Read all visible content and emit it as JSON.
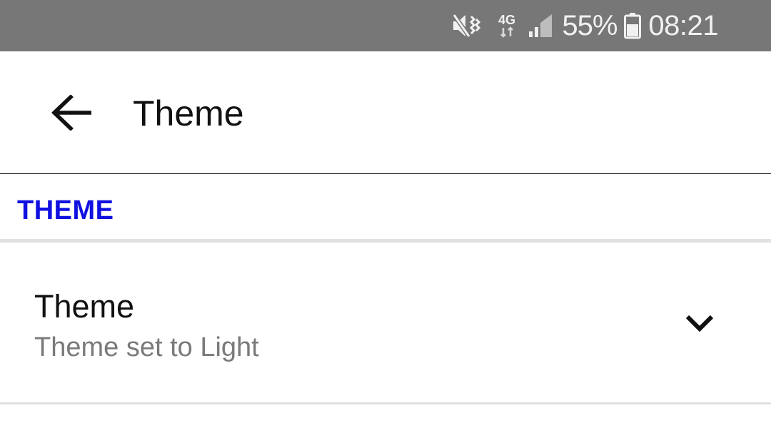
{
  "status_bar": {
    "battery_percent": "55%",
    "time": "08:21",
    "network_type": "4G",
    "icons": [
      "mute-vibrate-icon",
      "network-4g-icon",
      "signal-icon",
      "battery-icon"
    ]
  },
  "toolbar": {
    "back_icon": "arrow-back-icon",
    "title": "Theme"
  },
  "section": {
    "title": "THEME"
  },
  "preference": {
    "title": "Theme",
    "summary": "Theme set to Light",
    "icon": "chevron-down-icon"
  },
  "colors": {
    "status_bar_bg": "#777777",
    "accent": "#1010e0",
    "summary_text": "#7a7a7a",
    "divider": "#e1e1e1"
  }
}
